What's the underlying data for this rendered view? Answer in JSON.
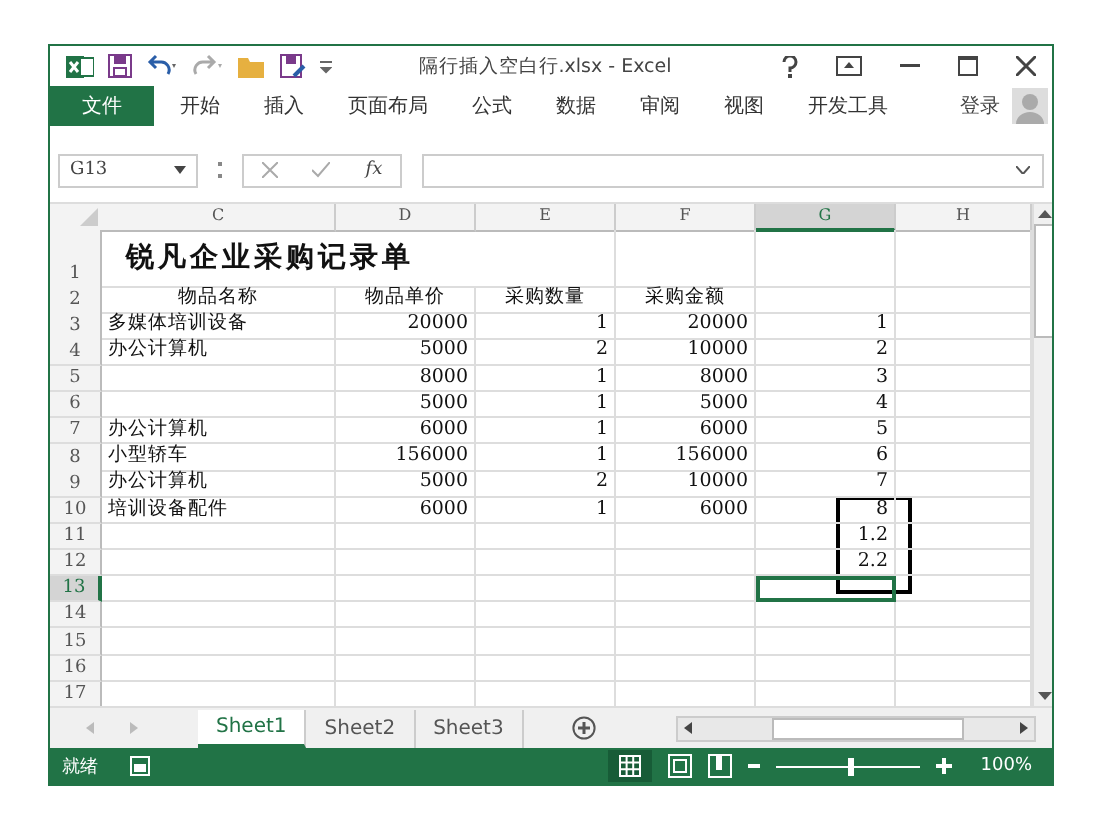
{
  "window": {
    "title": "隔行插入空白行.xlsx - Excel"
  },
  "ribbon_tabs": [
    {
      "label": "文件",
      "selected": true
    },
    {
      "label": "开始",
      "selected": false
    },
    {
      "label": "插入",
      "selected": false
    },
    {
      "label": "页面布局",
      "selected": false
    },
    {
      "label": "公式",
      "selected": false
    },
    {
      "label": "数据",
      "selected": false
    },
    {
      "label": "审阅",
      "selected": false
    },
    {
      "label": "视图",
      "selected": false
    },
    {
      "label": "开发工具",
      "selected": false
    }
  ],
  "sign_in": "登录",
  "formula_bar": {
    "name_box": "G13",
    "fx": "fx"
  },
  "columns": [
    {
      "label": "C",
      "selected": false
    },
    {
      "label": "D",
      "selected": false
    },
    {
      "label": "E",
      "selected": false
    },
    {
      "label": "F",
      "selected": false
    },
    {
      "label": "G",
      "selected": true
    },
    {
      "label": "H",
      "selected": false
    }
  ],
  "rows": [
    {
      "number": "1",
      "selected": false,
      "kind": "title",
      "cells": [
        "锐凡企业采购记录单"
      ]
    },
    {
      "number": "2",
      "selected": false,
      "kind": "header",
      "cells": [
        "物品名称",
        "物品单价",
        "采购数量",
        "采购金额"
      ]
    },
    {
      "number": "3",
      "selected": false,
      "kind": "data",
      "cells": [
        "多媒体培训设备",
        "20000",
        "1",
        "20000",
        "1"
      ]
    },
    {
      "number": "4",
      "selected": false,
      "kind": "data",
      "cells": [
        "办公计算机",
        "5000",
        "2",
        "10000",
        "2"
      ]
    },
    {
      "number": "5",
      "selected": false,
      "kind": "data",
      "cells": [
        "",
        "8000",
        "1",
        "8000",
        "3"
      ]
    },
    {
      "number": "6",
      "selected": false,
      "kind": "data",
      "cells": [
        "",
        "5000",
        "1",
        "5000",
        "4"
      ]
    },
    {
      "number": "7",
      "selected": false,
      "kind": "data",
      "cells": [
        "办公计算机",
        "6000",
        "1",
        "6000",
        "5"
      ]
    },
    {
      "number": "8",
      "selected": false,
      "kind": "data",
      "cells": [
        "小型轿车",
        "156000",
        "1",
        "156000",
        "6"
      ]
    },
    {
      "number": "9",
      "selected": false,
      "kind": "data",
      "cells": [
        "办公计算机",
        "5000",
        "2",
        "10000",
        "7"
      ]
    },
    {
      "number": "10",
      "selected": false,
      "kind": "data",
      "cells": [
        "培训设备配件",
        "6000",
        "1",
        "6000",
        "8"
      ]
    },
    {
      "number": "11",
      "selected": false,
      "kind": "data",
      "cells": [
        "",
        "",
        "",
        "",
        "1.2"
      ]
    },
    {
      "number": "12",
      "selected": false,
      "kind": "data",
      "cells": [
        "",
        "",
        "",
        "",
        "2.2"
      ]
    },
    {
      "number": "13",
      "selected": true,
      "kind": "data",
      "cells": []
    },
    {
      "number": "14",
      "selected": false,
      "kind": "data",
      "cells": []
    },
    {
      "number": "15",
      "selected": false,
      "kind": "data",
      "cells": []
    },
    {
      "number": "16",
      "selected": false,
      "kind": "data",
      "cells": []
    },
    {
      "number": "17",
      "selected": false,
      "kind": "data",
      "cells": []
    }
  ],
  "sheet_tabs": [
    {
      "label": "Sheet1",
      "selected": true
    },
    {
      "label": "Sheet2",
      "selected": false
    },
    {
      "label": "Sheet3",
      "selected": false
    }
  ],
  "status_bar": {
    "status": "就绪",
    "zoom_slider": {
      "level": 0.52
    },
    "zoom": "100%"
  }
}
